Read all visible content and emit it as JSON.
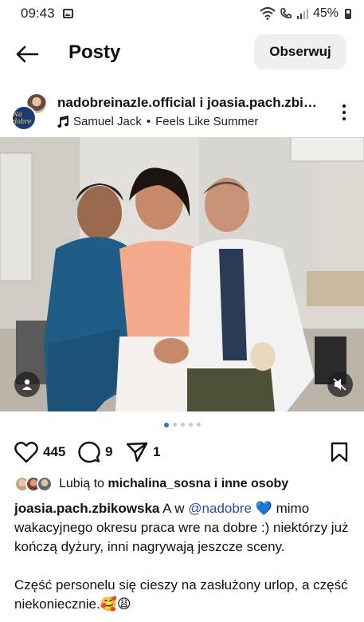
{
  "status_bar": {
    "time": "09:43",
    "battery": "45%"
  },
  "header": {
    "title": "Posty",
    "follow_label": "Obserwuj"
  },
  "post": {
    "usernames": "nadobreinazle.official i joasia.pach.zbi…",
    "music_artist": "Samuel Jack",
    "music_separator": "•",
    "music_title": "Feels Like Summer",
    "avatar_logo_text": "Na dobre",
    "carousel": {
      "count": 5,
      "active_index": 0
    }
  },
  "actions": {
    "likes_count": "445",
    "comments_count": "9",
    "shares_count": "1"
  },
  "likes_line": {
    "prefix": "Lubią to",
    "user": "michalina_sosna",
    "suffix": "i inne osoby"
  },
  "caption": {
    "author": "joasia.pach.zbikowska",
    "text_before_mention": "A w",
    "mention": "@nadobre",
    "emoji_heart": "💙",
    "text_line1_rest": "mimo wakacyjnego okresu praca wre na dobre :) niektórzy już kończą dyżury, inni nagrywają jeszcze sceny.",
    "paragraph2": "Część personelu się cieszy na zasłużony urlop, a część niekoniecznie.",
    "emoji_end": "🥰😩"
  },
  "icons": {
    "back": "arrow-left-icon",
    "more": "more-vertical-icon",
    "music": "music-note-icon",
    "like": "heart-icon",
    "comment": "comment-icon",
    "share": "send-icon",
    "save": "bookmark-icon",
    "mute": "speaker-muted-icon",
    "tag": "user-tag-icon"
  },
  "colors": {
    "accent": "#3b6fd8",
    "mention": "#2a4ea0",
    "follow_bg": "#efefef"
  }
}
